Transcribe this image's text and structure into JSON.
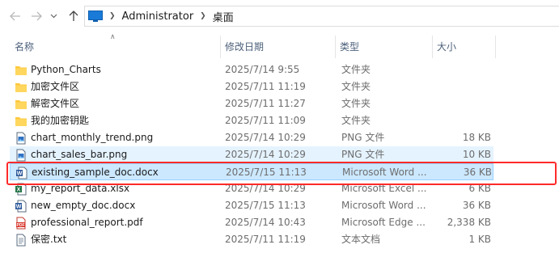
{
  "address": {
    "back_icon": "back-arrow-icon",
    "forward_icon": "forward-arrow-icon",
    "recent_icon": "chevron-down-icon",
    "up_icon": "up-arrow-icon",
    "path": [
      "Administrator",
      "桌面"
    ]
  },
  "columns": {
    "name": "名称",
    "date": "修改日期",
    "type": "类型",
    "size": "大小"
  },
  "files": [
    {
      "name": "Python_Charts",
      "date": "2025/7/14 9:55",
      "type": "文件夹",
      "size": "",
      "icon": "folder-icon",
      "state": ""
    },
    {
      "name": "加密文件区",
      "date": "2025/7/11 11:19",
      "type": "文件夹",
      "size": "",
      "icon": "folder-icon",
      "state": ""
    },
    {
      "name": "解密文件区",
      "date": "2025/7/11 11:27",
      "type": "文件夹",
      "size": "",
      "icon": "folder-icon",
      "state": ""
    },
    {
      "name": "我的加密钥匙",
      "date": "2025/7/11 11:09",
      "type": "文件夹",
      "size": "",
      "icon": "folder-icon",
      "state": ""
    },
    {
      "name": "chart_monthly_trend.png",
      "date": "2025/7/14 10:29",
      "type": "PNG 文件",
      "size": "18 KB",
      "icon": "image-file-icon",
      "state": ""
    },
    {
      "name": "chart_sales_bar.png",
      "date": "2025/7/14 10:29",
      "type": "PNG 文件",
      "size": "10 KB",
      "icon": "image-file-icon",
      "state": "hover"
    },
    {
      "name": "existing_sample_doc.docx",
      "date": "2025/7/15 11:13",
      "type": "Microsoft Word ...",
      "size": "36 KB",
      "icon": "word-file-icon",
      "state": "selected"
    },
    {
      "name": "my_report_data.xlsx",
      "date": "2025/7/14 10:29",
      "type": "Microsoft Excel ...",
      "size": "6 KB",
      "icon": "excel-file-icon",
      "state": ""
    },
    {
      "name": "new_empty_doc.docx",
      "date": "2025/7/15 11:13",
      "type": "Microsoft Word ...",
      "size": "36 KB",
      "icon": "word-file-icon",
      "state": ""
    },
    {
      "name": "professional_report.pdf",
      "date": "2025/7/14 10:43",
      "type": "Microsoft Edge ...",
      "size": "2,338 KB",
      "icon": "pdf-file-icon",
      "state": ""
    },
    {
      "name": "保密.txt",
      "date": "2025/7/11 11:19",
      "type": "文本文档",
      "size": "1 KB",
      "icon": "text-file-icon",
      "state": ""
    }
  ],
  "colors": {
    "selection_bg": "#cce8ff",
    "selection_border": "#99d1ff",
    "hover_bg": "#e5f3ff",
    "highlight_box": "#ff2a2a",
    "folder": "#ffc83d"
  }
}
